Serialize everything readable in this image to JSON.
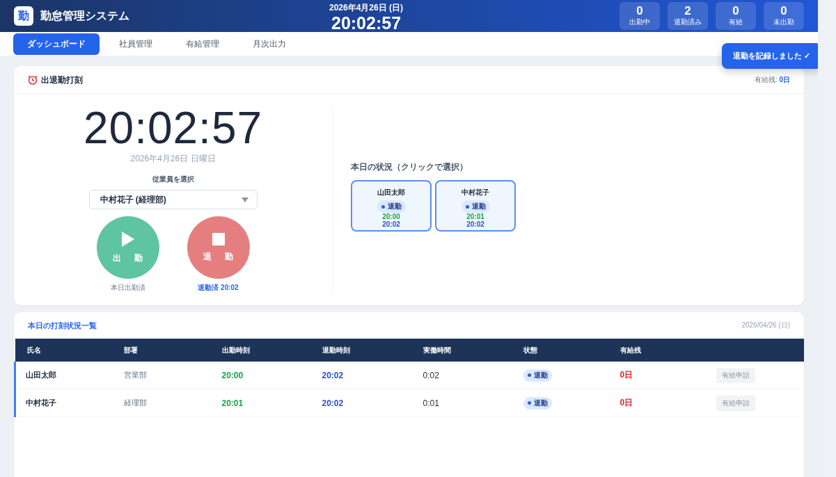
{
  "header": {
    "logo": "勤",
    "title": "勤怠管理システム",
    "date": "2026年4月26日 (日)",
    "time": "20:02:57",
    "stats": [
      {
        "value": "0",
        "label": "出勤中"
      },
      {
        "value": "2",
        "label": "退勤済み"
      },
      {
        "value": "0",
        "label": "有給"
      },
      {
        "value": "0",
        "label": "未出勤"
      }
    ]
  },
  "tabs": [
    {
      "label": "ダッシュボード",
      "selected": true
    },
    {
      "label": "社員管理",
      "selected": false
    },
    {
      "label": "有給管理",
      "selected": false
    },
    {
      "label": "月次出力",
      "selected": false
    }
  ],
  "toast": {
    "text": "退勤を記録しました ✓"
  },
  "punch": {
    "title": "出退勤打刻",
    "leave_label": "有給残:",
    "leave_value": "0日",
    "clock": "20:02:57",
    "date": "2026年4月26日 日曜日",
    "select_label": "従業員を選択",
    "select_value": "中村花子 (経理部)",
    "buttons": [
      {
        "kind": "clock_in",
        "label": "出 勤",
        "disabled": true,
        "note": "本日出勤済"
      },
      {
        "kind": "clock_out",
        "label": "退 勤",
        "disabled": true,
        "note": "退勤済 20:02"
      }
    ],
    "status_title": "本日の状況（クリックで選択）",
    "status_cards": [
      {
        "name": "山田太郎",
        "status": "退勤",
        "in": "20:00",
        "out": "20:02"
      },
      {
        "name": "中村花子",
        "status": "退勤",
        "in": "20:01",
        "out": "20:02"
      }
    ]
  },
  "table": {
    "title": "本日の打刻状況一覧",
    "date": "2026/04/26 (日)",
    "columns": [
      "氏名",
      "部署",
      "出勤時刻",
      "退勤時刻",
      "実働時間",
      "状態",
      "有給残"
    ],
    "rows": [
      {
        "name": "山田太郎",
        "dept": "営業部",
        "in": "20:00",
        "out": "20:02",
        "worked": "0:02",
        "status": "退勤",
        "leave": "0日",
        "action": "有給申請",
        "action_disabled": true
      },
      {
        "name": "中村花子",
        "dept": "経理部",
        "in": "20:01",
        "out": "20:02",
        "worked": "0:01",
        "status": "退勤",
        "leave": "0日",
        "action": "有給申請",
        "action_disabled": true
      }
    ]
  }
}
